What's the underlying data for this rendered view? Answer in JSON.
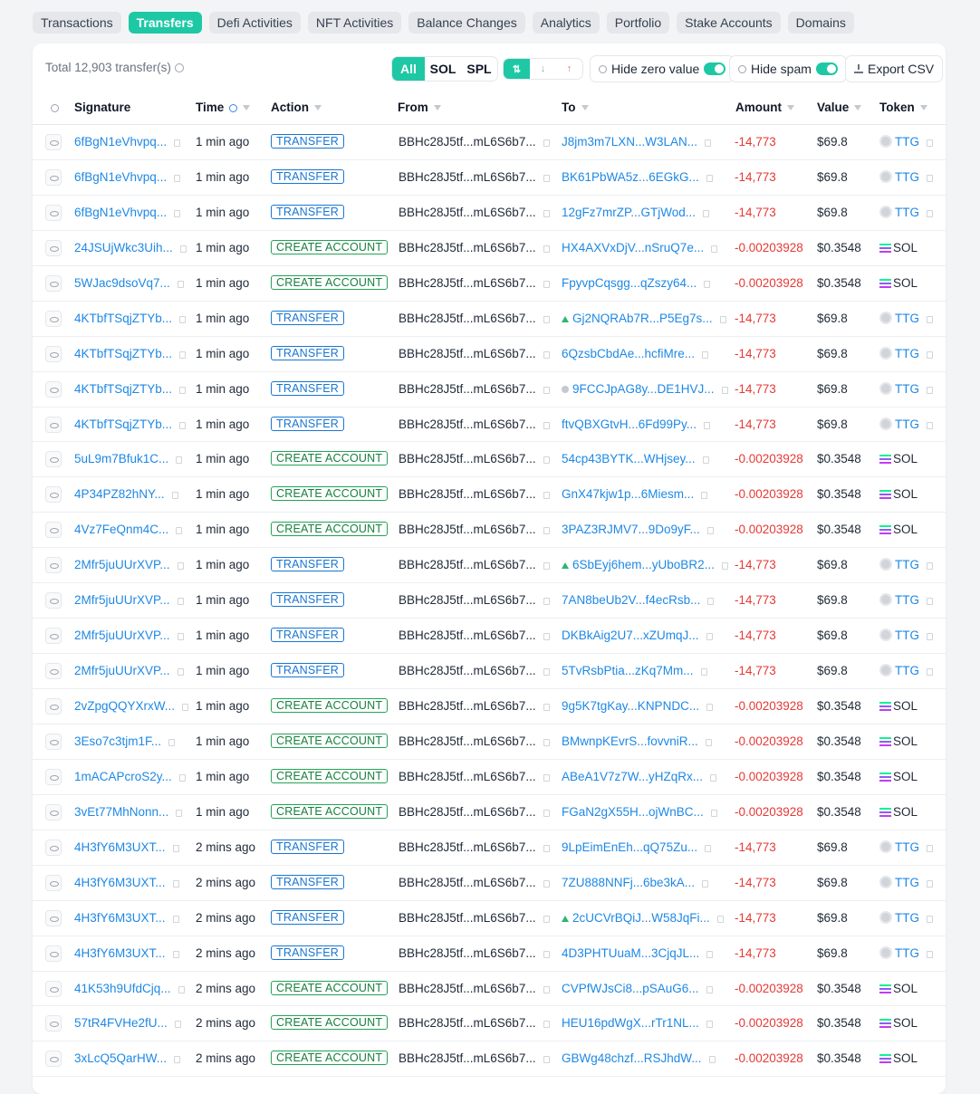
{
  "tabs": [
    {
      "label": "Transactions",
      "active": false
    },
    {
      "label": "Transfers",
      "active": true
    },
    {
      "label": "Defi Activities",
      "active": false
    },
    {
      "label": "NFT Activities",
      "active": false
    },
    {
      "label": "Balance Changes",
      "active": false
    },
    {
      "label": "Analytics",
      "active": false
    },
    {
      "label": "Portfolio",
      "active": false
    },
    {
      "label": "Stake Accounts",
      "active": false
    },
    {
      "label": "Domains",
      "active": false
    }
  ],
  "toolbar": {
    "total": "Total 12,903 transfer(s)",
    "filters": [
      "All",
      "SOL",
      "SPL"
    ],
    "sort_icons": [
      "⇅",
      "↓",
      "↑"
    ],
    "hide_zero": "Hide zero value",
    "hide_spam": "Hide spam",
    "export": "Export CSV"
  },
  "columns": {
    "signature": "Signature",
    "time": "Time",
    "action": "Action",
    "from": "From",
    "to": "To",
    "amount": "Amount",
    "value": "Value",
    "token": "Token"
  },
  "colors": {
    "accent": "#1ec8a5",
    "link": "#1e88e5",
    "negative": "#e53935",
    "transfer_badge": "#1976d2",
    "create_badge": "#22a355"
  },
  "rows": [
    {
      "sig": "6fBgN1eVhvpq...",
      "time": "1 min ago",
      "action": "TRANSFER",
      "from": "BBHc28J5tf...mL6S6b7...",
      "marker": "",
      "to": "J8jm3m7LXN...W3LAN...",
      "amount": "-14,773",
      "value": "$69.8",
      "token": "TTG"
    },
    {
      "sig": "6fBgN1eVhvpq...",
      "time": "1 min ago",
      "action": "TRANSFER",
      "from": "BBHc28J5tf...mL6S6b7...",
      "marker": "",
      "to": "BK61PbWA5z...6EGkG...",
      "amount": "-14,773",
      "value": "$69.8",
      "token": "TTG"
    },
    {
      "sig": "6fBgN1eVhvpq...",
      "time": "1 min ago",
      "action": "TRANSFER",
      "from": "BBHc28J5tf...mL6S6b7...",
      "marker": "",
      "to": "12gFz7mrZP...GTjWod...",
      "amount": "-14,773",
      "value": "$69.8",
      "token": "TTG"
    },
    {
      "sig": "24JSUjWkc3Uih...",
      "time": "1 min ago",
      "action": "CREATE ACCOUNT",
      "from": "BBHc28J5tf...mL6S6b7...",
      "marker": "",
      "to": "HX4AXVxDjV...nSruQ7e...",
      "amount": "-0.00203928",
      "value": "$0.3548",
      "token": "SOL"
    },
    {
      "sig": "5WJac9dsoVq7...",
      "time": "1 min ago",
      "action": "CREATE ACCOUNT",
      "from": "BBHc28J5tf...mL6S6b7...",
      "marker": "",
      "to": "FpyvpCqsgg...qZszy64...",
      "amount": "-0.00203928",
      "value": "$0.3548",
      "token": "SOL"
    },
    {
      "sig": "4KTbfTSqjZTYb...",
      "time": "1 min ago",
      "action": "TRANSFER",
      "from": "BBHc28J5tf...mL6S6b7...",
      "marker": "tri",
      "to": "Gj2NQRAb7R...P5Eg7s...",
      "amount": "-14,773",
      "value": "$69.8",
      "token": "TTG"
    },
    {
      "sig": "4KTbfTSqjZTYb...",
      "time": "1 min ago",
      "action": "TRANSFER",
      "from": "BBHc28J5tf...mL6S6b7...",
      "marker": "",
      "to": "6QzsbCbdAe...hcfiMre...",
      "amount": "-14,773",
      "value": "$69.8",
      "token": "TTG"
    },
    {
      "sig": "4KTbfTSqjZTYb...",
      "time": "1 min ago",
      "action": "TRANSFER",
      "from": "BBHc28J5tf...mL6S6b7...",
      "marker": "dot",
      "to": "9FCCJpAG8y...DE1HVJ...",
      "amount": "-14,773",
      "value": "$69.8",
      "token": "TTG"
    },
    {
      "sig": "4KTbfTSqjZTYb...",
      "time": "1 min ago",
      "action": "TRANSFER",
      "from": "BBHc28J5tf...mL6S6b7...",
      "marker": "",
      "to": "ftvQBXGtvH...6Fd99Py...",
      "amount": "-14,773",
      "value": "$69.8",
      "token": "TTG"
    },
    {
      "sig": "5uL9m7Bfuk1C...",
      "time": "1 min ago",
      "action": "CREATE ACCOUNT",
      "from": "BBHc28J5tf...mL6S6b7...",
      "marker": "",
      "to": "54cp43BYTK...WHjsey...",
      "amount": "-0.00203928",
      "value": "$0.3548",
      "token": "SOL"
    },
    {
      "sig": "4P34PZ82hNY...",
      "time": "1 min ago",
      "action": "CREATE ACCOUNT",
      "from": "BBHc28J5tf...mL6S6b7...",
      "marker": "",
      "to": "GnX47kjw1p...6Miesm...",
      "amount": "-0.00203928",
      "value": "$0.3548",
      "token": "SOL"
    },
    {
      "sig": "4Vz7FeQnm4C...",
      "time": "1 min ago",
      "action": "CREATE ACCOUNT",
      "from": "BBHc28J5tf...mL6S6b7...",
      "marker": "",
      "to": "3PAZ3RJMV7...9Do9yF...",
      "amount": "-0.00203928",
      "value": "$0.3548",
      "token": "SOL"
    },
    {
      "sig": "2Mfr5juUUrXVP...",
      "time": "1 min ago",
      "action": "TRANSFER",
      "from": "BBHc28J5tf...mL6S6b7...",
      "marker": "tri",
      "to": "6SbEyj6hem...yUboBR2...",
      "amount": "-14,773",
      "value": "$69.8",
      "token": "TTG"
    },
    {
      "sig": "2Mfr5juUUrXVP...",
      "time": "1 min ago",
      "action": "TRANSFER",
      "from": "BBHc28J5tf...mL6S6b7...",
      "marker": "",
      "to": "7AN8beUb2V...f4ecRsb...",
      "amount": "-14,773",
      "value": "$69.8",
      "token": "TTG"
    },
    {
      "sig": "2Mfr5juUUrXVP...",
      "time": "1 min ago",
      "action": "TRANSFER",
      "from": "BBHc28J5tf...mL6S6b7...",
      "marker": "",
      "to": "DKBkAig2U7...xZUmqJ...",
      "amount": "-14,773",
      "value": "$69.8",
      "token": "TTG"
    },
    {
      "sig": "2Mfr5juUUrXVP...",
      "time": "1 min ago",
      "action": "TRANSFER",
      "from": "BBHc28J5tf...mL6S6b7...",
      "marker": "",
      "to": "5TvRsbPtia...zKq7Mm...",
      "amount": "-14,773",
      "value": "$69.8",
      "token": "TTG"
    },
    {
      "sig": "2vZpgQQYXrxW...",
      "time": "1 min ago",
      "action": "CREATE ACCOUNT",
      "from": "BBHc28J5tf...mL6S6b7...",
      "marker": "",
      "to": "9g5K7tgKay...KNPNDC...",
      "amount": "-0.00203928",
      "value": "$0.3548",
      "token": "SOL"
    },
    {
      "sig": "3Eso7c3tjm1F...",
      "time": "1 min ago",
      "action": "CREATE ACCOUNT",
      "from": "BBHc28J5tf...mL6S6b7...",
      "marker": "",
      "to": "BMwnpKEvrS...fovvniR...",
      "amount": "-0.00203928",
      "value": "$0.3548",
      "token": "SOL"
    },
    {
      "sig": "1mACAPcroS2y...",
      "time": "1 min ago",
      "action": "CREATE ACCOUNT",
      "from": "BBHc28J5tf...mL6S6b7...",
      "marker": "",
      "to": "ABeA1V7z7W...yHZqRx...",
      "amount": "-0.00203928",
      "value": "$0.3548",
      "token": "SOL"
    },
    {
      "sig": "3vEt77MhNonn...",
      "time": "1 min ago",
      "action": "CREATE ACCOUNT",
      "from": "BBHc28J5tf...mL6S6b7...",
      "marker": "",
      "to": "FGaN2gX55H...ojWnBC...",
      "amount": "-0.00203928",
      "value": "$0.3548",
      "token": "SOL"
    },
    {
      "sig": "4H3fY6M3UXT...",
      "time": "2 mins ago",
      "action": "TRANSFER",
      "from": "BBHc28J5tf...mL6S6b7...",
      "marker": "",
      "to": "9LpEimEnEh...qQ75Zu...",
      "amount": "-14,773",
      "value": "$69.8",
      "token": "TTG"
    },
    {
      "sig": "4H3fY6M3UXT...",
      "time": "2 mins ago",
      "action": "TRANSFER",
      "from": "BBHc28J5tf...mL6S6b7...",
      "marker": "",
      "to": "7ZU888NNFj...6be3kA...",
      "amount": "-14,773",
      "value": "$69.8",
      "token": "TTG"
    },
    {
      "sig": "4H3fY6M3UXT...",
      "time": "2 mins ago",
      "action": "TRANSFER",
      "from": "BBHc28J5tf...mL6S6b7...",
      "marker": "tri",
      "to": "2cUCVrBQiJ...W58JqFi...",
      "amount": "-14,773",
      "value": "$69.8",
      "token": "TTG"
    },
    {
      "sig": "4H3fY6M3UXT...",
      "time": "2 mins ago",
      "action": "TRANSFER",
      "from": "BBHc28J5tf...mL6S6b7...",
      "marker": "",
      "to": "4D3PHTUuaM...3CjqJL...",
      "amount": "-14,773",
      "value": "$69.8",
      "token": "TTG"
    },
    {
      "sig": "41K53h9UfdCjq...",
      "time": "2 mins ago",
      "action": "CREATE ACCOUNT",
      "from": "BBHc28J5tf...mL6S6b7...",
      "marker": "",
      "to": "CVPfWJsCi8...pSAuG6...",
      "amount": "-0.00203928",
      "value": "$0.3548",
      "token": "SOL"
    },
    {
      "sig": "57tR4FVHe2fU...",
      "time": "2 mins ago",
      "action": "CREATE ACCOUNT",
      "from": "BBHc28J5tf...mL6S6b7...",
      "marker": "",
      "to": "HEU16pdWgX...rTr1NL...",
      "amount": "-0.00203928",
      "value": "$0.3548",
      "token": "SOL"
    },
    {
      "sig": "3xLcQ5QarHW...",
      "time": "2 mins ago",
      "action": "CREATE ACCOUNT",
      "from": "BBHc28J5tf...mL6S6b7...",
      "marker": "",
      "to": "GBWg48chzf...RSJhdW...",
      "amount": "-0.00203928",
      "value": "$0.3548",
      "token": "SOL"
    }
  ]
}
